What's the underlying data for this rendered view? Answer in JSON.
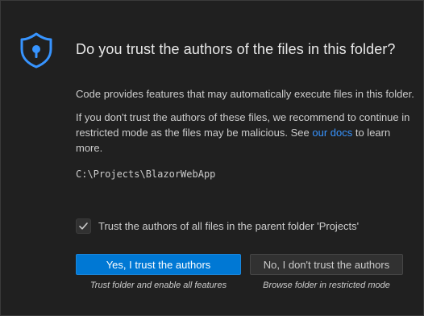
{
  "dialog": {
    "title": "Do you trust the authors of the files in this folder?",
    "paragraph1": "Code provides features that may automatically execute files in this folder.",
    "paragraph2_before_link": "If you don't trust the authors of these files, we recommend to continue in restricted mode as the files may be malicious. See ",
    "paragraph2_link": "our docs",
    "paragraph2_after_link": " to learn more.",
    "folder_path": "C:\\Projects\\BlazorWebApp",
    "checkbox_label": "Trust the authors of all files in the parent folder 'Projects'",
    "checkbox_checked": true,
    "trust_button_label": "Yes, I trust the authors",
    "trust_button_caption": "Trust folder and enable all features",
    "distrust_button_label": "No, I don't trust the authors",
    "distrust_button_caption": "Browse folder in restricted mode"
  },
  "icons": {
    "shield": "shield-lock-icon",
    "check": "checkmark-icon"
  },
  "colors": {
    "accent": "#0078d4",
    "link": "#3794ff",
    "shield": "#3794ff",
    "background": "#202020"
  }
}
